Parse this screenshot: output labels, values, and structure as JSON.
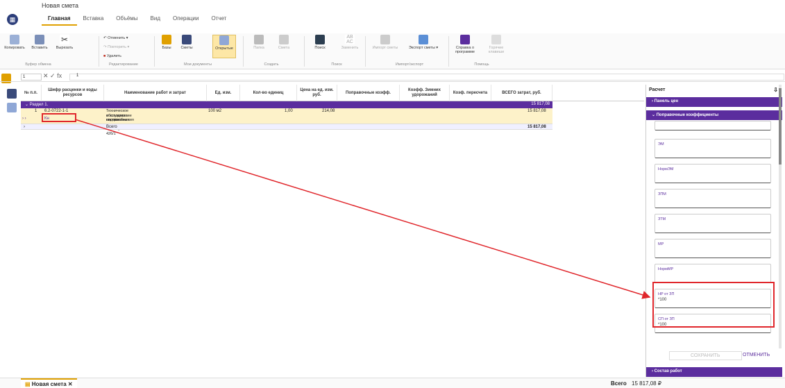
{
  "app": {
    "title": "Новая смета"
  },
  "menu": [
    "Главная",
    "Вставка",
    "Объёмы",
    "Вид",
    "Операции",
    "Отчет"
  ],
  "ribbon": {
    "copy": "Копировать",
    "paste": "Вставить",
    "cut": "Вырезать",
    "clipboard_group": "Буфер обмена",
    "undo": "Отменить",
    "redo": "Повторить",
    "delete": "Удалить",
    "edit_group": "Редактирование",
    "bases": "Базы",
    "estimates": "Сметы",
    "open": "Открытые",
    "docs_group": "Мои документы",
    "folder": "Папка",
    "estimate": "Смета",
    "create_group": "Создать",
    "search": "Поиск",
    "replace": "Заменить",
    "search_group": "Поиск",
    "import": "Импорт сметы",
    "export": "Экспорт сметы",
    "io_group": "Импорт/экспорт",
    "about": "Справка о программе",
    "hotkeys": "Горячие клавиши",
    "help_group": "Помощь"
  },
  "formula": {
    "cell": "1",
    "value": "1",
    "ops": "✕ ✓ fx"
  },
  "grid": {
    "headers": [
      "№ п.п.",
      "Шифр расценки и коды ресурсов",
      "Наименование работ и затрат",
      "Ед. изм.",
      "Кол-во единиц",
      "Цена на ед. изм. руб.",
      "Поправочные коэфф.",
      "Коэфф. Зимних удорожаний",
      "Коэф. пересчета",
      "ВСЕГО затрат, руб."
    ],
    "section": {
      "label": "Раздел 1.",
      "total": "15 817,08"
    },
    "row": {
      "num": "1",
      "code": "6.2-0722-1-1",
      "code2": "Кн",
      "name1": "Техническое обслуживание систем горячего",
      "name2": "и холодного водоснабжения цокол,",
      "name3": "построенных по типовому проекту 65-426/1",
      "unit": "100 м2",
      "qty": "1,00",
      "price": "214,08",
      "total": "15 817,08",
      "nav": "› ›"
    },
    "total_row": {
      "label": "Всего",
      "total": "15 817,08",
      "nav": "›"
    }
  },
  "panel": {
    "title": "Расчет",
    "bar1": "Панель цен",
    "bar2": "Поправочные коэффициенты",
    "fields": [
      {
        "label": "ЭМ",
        "value": ""
      },
      {
        "label": "НормЭМ",
        "value": ""
      },
      {
        "label": "ЗПМ",
        "value": ""
      },
      {
        "label": "ЗТМ",
        "value": ""
      },
      {
        "label": "МР",
        "value": ""
      },
      {
        "label": "НормМР",
        "value": ""
      },
      {
        "label": "НР от ЗП",
        "value": "*100"
      },
      {
        "label": "СП от ЗП",
        "value": "*100"
      }
    ],
    "save": "СОХРАНИТЬ",
    "cancel": "ОТМЕНИТЬ",
    "bar3": "Состав работ"
  },
  "status": {
    "tab": "Новая смета",
    "total_label": "Всего",
    "total_value": "15 817,08 ₽"
  },
  "colors": {
    "accent": "#5b2d9e",
    "highlight": "#fdf2c9",
    "annotation": "#e0262b"
  }
}
